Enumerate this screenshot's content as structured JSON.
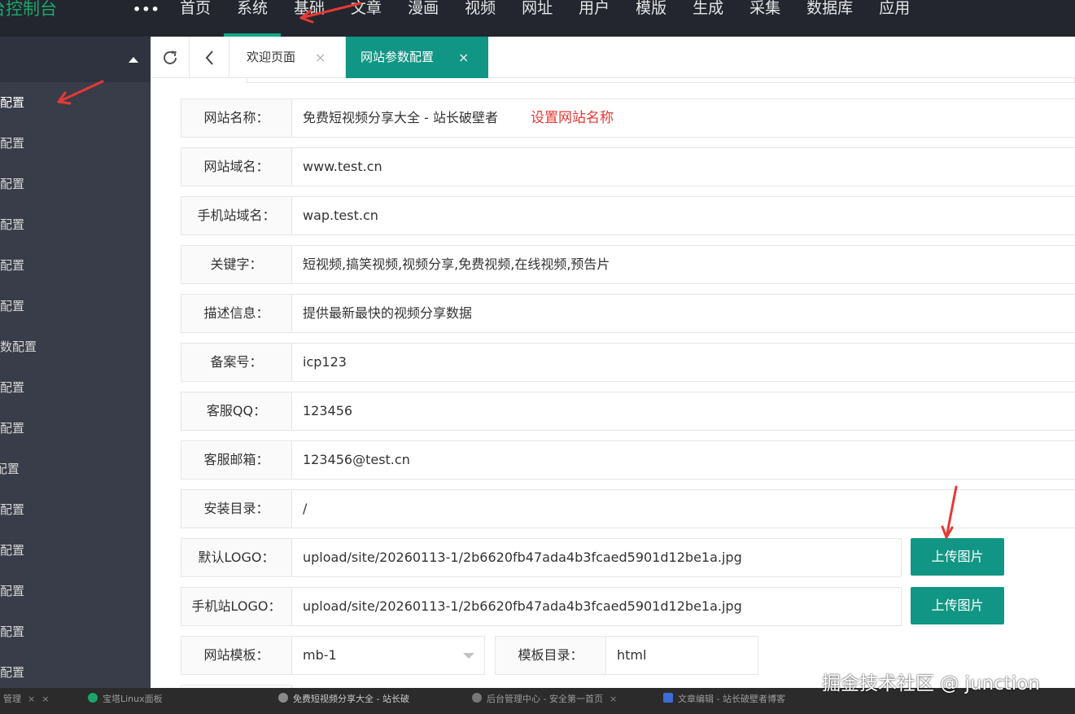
{
  "topbar": {
    "brand": "台控制台",
    "more": "•••",
    "nav": [
      "首页",
      "系统",
      "基础",
      "文章",
      "漫画",
      "视频",
      "网址",
      "用户",
      "模版",
      "生成",
      "采集",
      "数据库",
      "应用"
    ],
    "active_nav": "系统"
  },
  "sidebar": {
    "items": [
      "参数配置",
      "参数配置",
      "参数配置",
      "留言配置",
      "参数配置",
      "地址配置",
      "器参数配置",
      "参数配置",
      "入库配置",
      "API配置",
      "登录配置",
      "支付配置",
      "对接配置",
      "发送配置",
      "发送配置"
    ]
  },
  "tabs": {
    "welcome": "欢迎页面",
    "site_config": "网站参数配置",
    "close": "×"
  },
  "form": {
    "site_name": {
      "label": "网站名称：",
      "value": "免费短视频分享大全 - 站长破壁者",
      "hint": "设置网站名称"
    },
    "site_domain": {
      "label": "网站域名：",
      "value": "www.test.cn"
    },
    "mobile_domain": {
      "label": "手机站域名：",
      "value": "wap.test.cn"
    },
    "keywords": {
      "label": "关键字：",
      "value": "短视频,搞笑视频,视频分享,免费视频,在线视频,预告片"
    },
    "description": {
      "label": "描述信息：",
      "value": "提供最新最快的视频分享数据"
    },
    "icp": {
      "label": "备案号：",
      "value": "icp123"
    },
    "service_qq": {
      "label": "客服QQ：",
      "value": "123456"
    },
    "service_email": {
      "label": "客服邮箱：",
      "value": "123456@test.cn"
    },
    "install_dir": {
      "label": "安装目录：",
      "value": "/"
    },
    "default_logo": {
      "label": "默认LOGO：",
      "value": "upload/site/20260113-1/2b6620fb47ada4b3fcaed5901d12be1a.jpg",
      "button": "上传图片"
    },
    "mobile_logo": {
      "label": "手机站LOGO：",
      "value": "upload/site/20260113-1/2b6620fb47ada4b3fcaed5901d12be1a.jpg",
      "button": "上传图片"
    },
    "template": {
      "label": "网站模板：",
      "value": "mb-1"
    },
    "template_dir": {
      "label": "模板目录：",
      "value": "html"
    }
  },
  "taskbar": {
    "items": [
      "管理",
      "宝塔Linux面板",
      "免费短视频分享大全 - 站长破",
      "后台管理中心 - 安全第一首页",
      "文章编辑 - 站长破壁者博客"
    ],
    "close": "×"
  },
  "watermark": "掘金技术社区 @ junction",
  "colors": {
    "accent": "#119685",
    "dark_bg": "#23262e",
    "sidebar_bg": "#393d49",
    "brand": "#1aa66a",
    "annotation": "#e53935"
  }
}
